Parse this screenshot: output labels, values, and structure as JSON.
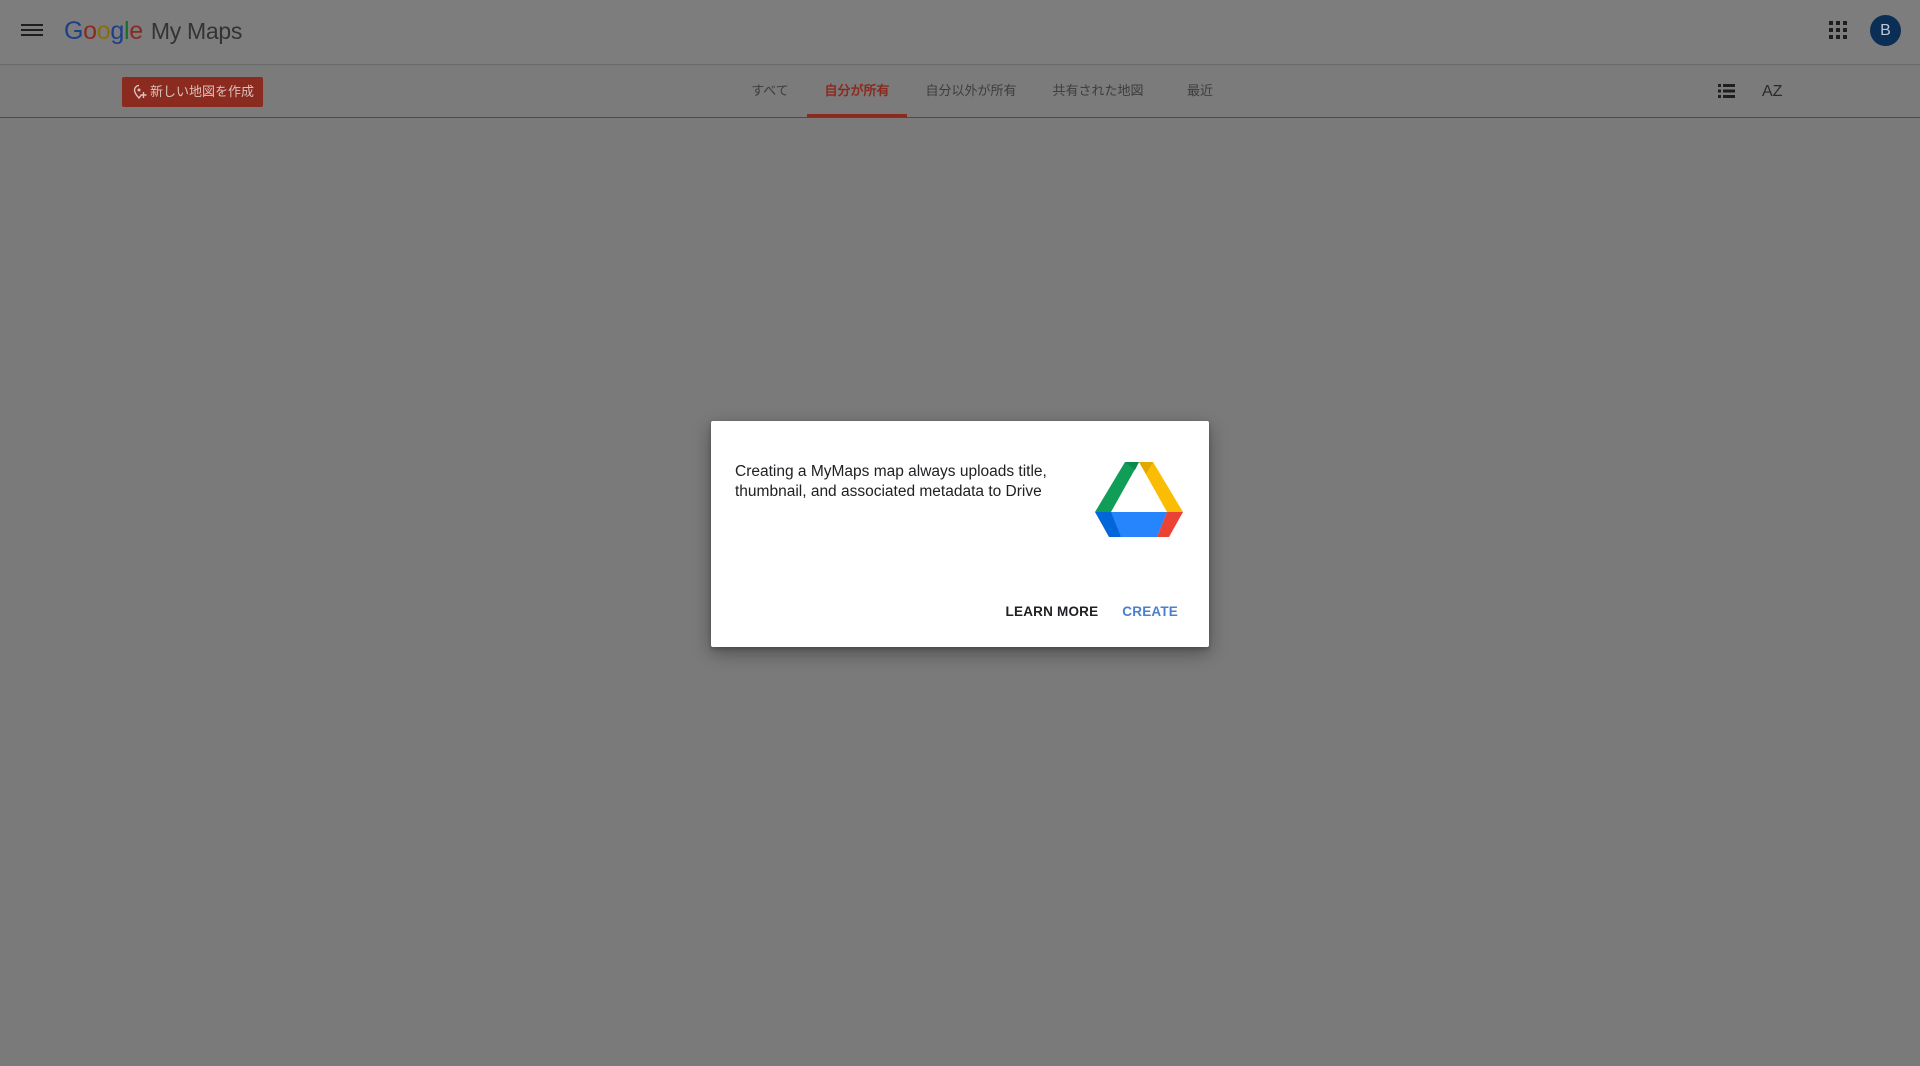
{
  "header": {
    "logo_letters": [
      "G",
      "o",
      "o",
      "g",
      "l",
      "e"
    ],
    "product_name": "My Maps",
    "avatar_initial": "B"
  },
  "toolbar": {
    "create_map_label": "新しい地図を作成",
    "tabs": [
      {
        "label": "すべて",
        "active": false
      },
      {
        "label": "自分が所有",
        "active": true
      },
      {
        "label": "自分以外が所有",
        "active": false
      },
      {
        "label": "共有された地図",
        "active": false
      },
      {
        "label": "最近",
        "active": false
      }
    ],
    "sort_label": "AZ"
  },
  "dialog": {
    "message": "Creating a MyMaps map always uploads title, thumbnail, and associated metadata to Drive",
    "learn_more_label": "LEARN MORE",
    "create_label": "CREATE"
  },
  "colors": {
    "accent_red": "#c53929",
    "create_blue": "#4285f4",
    "avatar_bg": "#0b4a8b"
  },
  "icons": {
    "menu": "menu-icon",
    "apps": "apps-grid-icon",
    "add_map": "add-location-icon",
    "list_view": "list-view-icon",
    "sort": "sort-az-icon",
    "drive": "google-drive-icon"
  }
}
